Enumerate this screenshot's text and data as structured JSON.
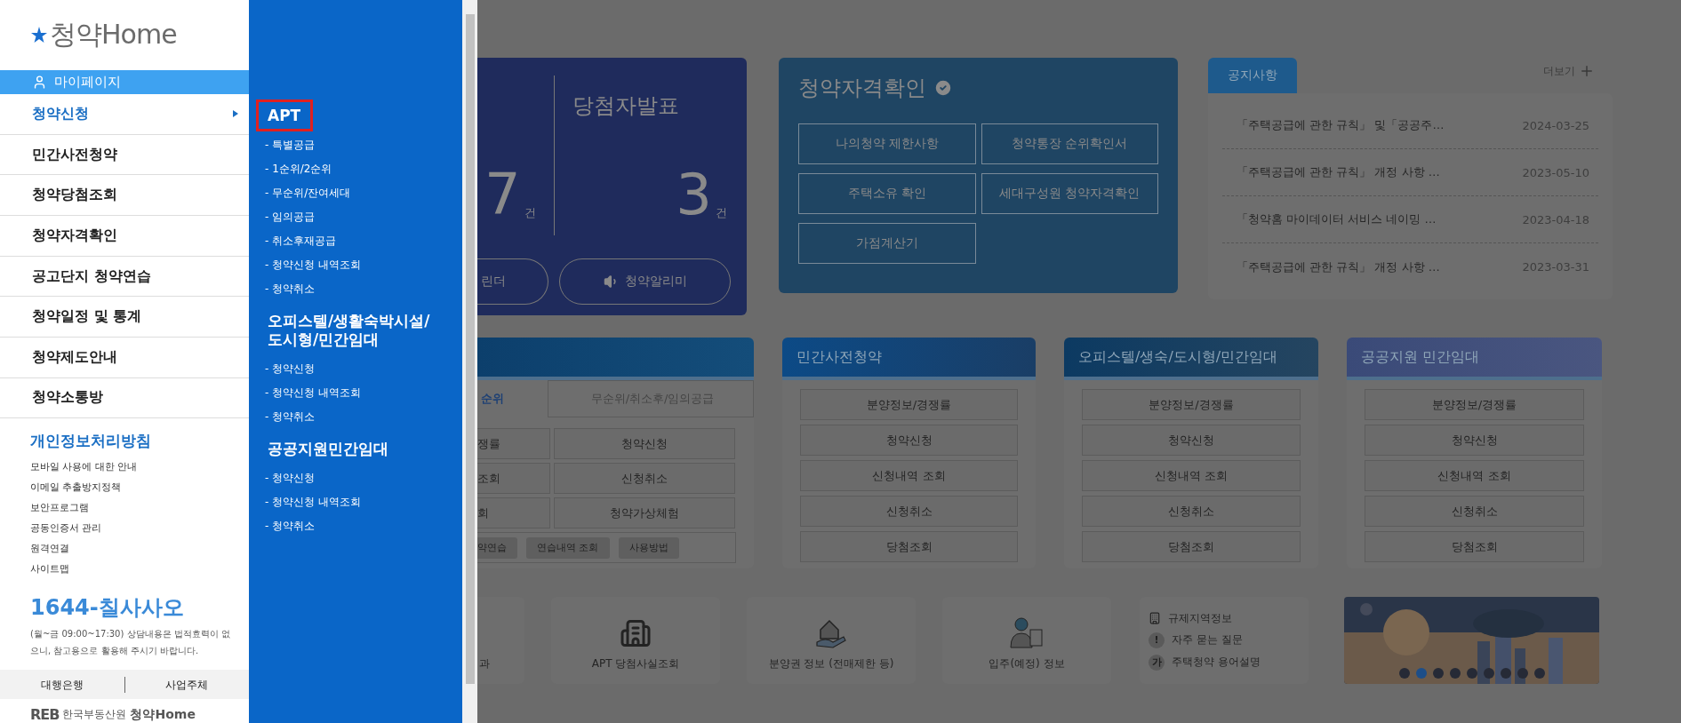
{
  "logo": {
    "text": "청약Home"
  },
  "sidebar": {
    "mypage": "마이페이지",
    "menu": [
      {
        "label": "청약신청",
        "selected": true
      },
      {
        "label": "민간사전청약",
        "selected": false
      },
      {
        "label": "청약당첨조회",
        "selected": false
      },
      {
        "label": "청약자격확인",
        "selected": false
      },
      {
        "label": "공고단지 청약연습",
        "selected": false
      },
      {
        "label": "청약일정 및 통계",
        "selected": false
      },
      {
        "label": "청약제도안내",
        "selected": false
      },
      {
        "label": "청약소통방",
        "selected": false
      }
    ],
    "policy_link": "개인정보처리방침",
    "links": [
      "모바일 사용에 대한 안내",
      "이메일 추출방지정책",
      "보안프로그램",
      "공동인증서 관리",
      "원격연결",
      "사이트맵"
    ],
    "phone": {
      "number": "1644-",
      "name": "칠사사오"
    },
    "hours_note": "(월~금 09:00~17:30) 상담내용은 법적효력이 없으니, 참고용으로 활용해 주시기 바랍니다.",
    "footer_tabs": [
      "대행은행",
      "사업주체"
    ],
    "footer_logo": {
      "mark": "REB",
      "org": "한국부동산원",
      "brand": "청약Home"
    }
  },
  "submenu": [
    {
      "title": "APT",
      "highlighted": true,
      "items": [
        "- 특별공급",
        "- 1순위/2순위",
        "- 무순위/잔여세대",
        "- 임의공급",
        "- 취소후재공급",
        "- 청약신청 내역조회",
        "- 청약취소"
      ]
    },
    {
      "title": "오피스텔/생활숙박시설/\n도시형/민간임대",
      "highlighted": false,
      "items": [
        "- 청약신청",
        "- 청약신청 내역조회",
        "- 청약취소"
      ]
    },
    {
      "title": "공공지원민간임대",
      "highlighted": false,
      "items": [
        "- 청약신청",
        "- 청약신청 내역조회",
        "- 청약취소"
      ]
    }
  ],
  "summary_card": {
    "left_count": "7",
    "left_unit": "건",
    "title": "당첨자발표",
    "count": "3",
    "unit": "건",
    "cut_button": "린더",
    "alarm_button": "청약알리미"
  },
  "eligibility": {
    "title": "청약자격확인",
    "buttons": [
      "나의청약 제한사항",
      "청약통장 순위확인서",
      "주택소유 확인",
      "세대구성원 청약자격확인",
      "가점계산기"
    ]
  },
  "notices": {
    "tab": "공지사항",
    "more": "더보기",
    "items": [
      {
        "title": "「주택공급에 관한 규칙」 및「공공주…",
        "date": "2024-03-25"
      },
      {
        "title": "「주택공급에 관한 규칙」 개정 사항 …",
        "date": "2023-05-10"
      },
      {
        "title": "「청약홈 마이데이터 서비스 네이밍 …",
        "date": "2023-04-18"
      },
      {
        "title": "「주택공급에 관한 규칙」 개정 사항 …",
        "date": "2023-03-31"
      }
    ]
  },
  "service_cards": [
    {
      "kind": "tabbed",
      "tabs": [
        {
          "label": "순위",
          "selected": true
        },
        {
          "label": "무순위/취소후/임의공급",
          "selected": false
        }
      ],
      "buttons": [
        "쟁률",
        "청약신청",
        "조회",
        "신청취소",
        "회",
        "청약가상체험"
      ],
      "small_buttons": [
        "약연습",
        "연습내역 조회",
        "사용방법"
      ]
    },
    {
      "kind": "list",
      "title": "민간사전청약",
      "buttons": [
        "분양정보/경쟁률",
        "청약신청",
        "신청내역 조회",
        "신청취소",
        "당첨조회"
      ]
    },
    {
      "kind": "list",
      "title": "오피스텔/생숙/도시형/민간임대",
      "buttons": [
        "분양정보/경쟁률",
        "청약신청",
        "신청내역 조회",
        "신청취소",
        "당첨조회"
      ]
    },
    {
      "kind": "list",
      "title": "공공지원 민간임대",
      "buttons": [
        "분양정보/경쟁률",
        "청약신청",
        "신청내역 조회",
        "신청취소",
        "당첨조회"
      ]
    }
  ],
  "quick_links": [
    {
      "label": "과",
      "kind": "cut"
    },
    {
      "label": "APT 당첨사실조회",
      "kind": "building"
    },
    {
      "label": "분양권 정보 (전매제한 등)",
      "kind": "house"
    },
    {
      "label": "입주(예정) 정보",
      "kind": "person"
    }
  ],
  "info_links": [
    {
      "kind": "icon",
      "label": "규제지역정보"
    },
    {
      "kind": "badge",
      "badge": "!",
      "label": "자주 묻는 질문"
    },
    {
      "kind": "badge",
      "badge": "가",
      "label": "주택청약 용어설명"
    }
  ],
  "banner": {
    "kind": "picture",
    "dots": [
      {
        "selected": false
      },
      {
        "selected": true
      },
      {
        "selected": false
      },
      {
        "selected": false
      },
      {
        "selected": false
      },
      {
        "selected": false
      },
      {
        "selected": false
      },
      {
        "selected": false
      },
      {
        "selected": false
      }
    ]
  }
}
